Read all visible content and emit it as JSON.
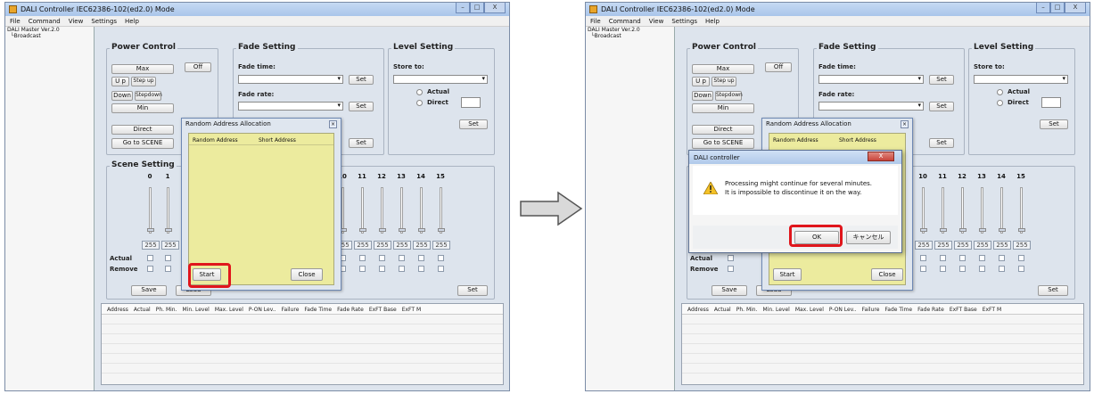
{
  "window": {
    "title": "DALI Controller IEC62386-102(ed2.0) Mode",
    "btn_min": "–",
    "btn_max": "□",
    "btn_close": "X"
  },
  "menu": [
    "File",
    "Command",
    "View",
    "Settings",
    "Help"
  ],
  "tree": {
    "root": "DALI Master Ver.2.0",
    "child": "Broadcast"
  },
  "power": {
    "title": "Power Control",
    "max": "Max",
    "off": "Off",
    "up": "U p",
    "step_up": "Step up",
    "down": "Down",
    "step_down": "Stepdown",
    "min": "Min",
    "direct": "Direct",
    "go_scene": "Go to SCENE"
  },
  "fade": {
    "title": "Fade Setting",
    "time": "Fade time:",
    "rate": "Fade rate:",
    "set": "Set"
  },
  "level": {
    "title": "Level Setting",
    "store_to": "Store to:",
    "actual": "Actual",
    "direct": "Direct",
    "set": "Set"
  },
  "scene": {
    "title": "Scene Setting",
    "left_numbers": [
      "0",
      "1"
    ],
    "right_numbers_left": [
      "9",
      "10",
      "11",
      "12",
      "13",
      "14",
      "15"
    ],
    "right_numbers_right": [
      "9",
      "10",
      "11",
      "12",
      "13",
      "14",
      "15"
    ],
    "value": "255",
    "actual": "Actual",
    "remove": "Remove",
    "save": "Save",
    "load": "Load",
    "set": "Set"
  },
  "table": {
    "headers_left": [
      "Address",
      "Actual",
      "Ph. Min.",
      "Min. Level",
      "Max. Level",
      "P-ON Lev..",
      "Failure",
      "Fade Time",
      "Fade Rate",
      "ExFT Base",
      "ExFT M"
    ],
    "headers_right": [
      "Address",
      "Actual",
      "Ph. Min.",
      "Min. Level",
      "Max. Level",
      "P-ON Lev..",
      "Failure",
      "Fade Time",
      "Fade Rate",
      "ExFT Base",
      "ExFT M"
    ]
  },
  "rand_dialog": {
    "title": "Random Address Allocation",
    "col_random": "Random Address",
    "col_short": "Short Address",
    "start": "Start",
    "close": "Close",
    "x": "×"
  },
  "alert": {
    "title": "DALI controller",
    "line1": "Processing might continue for several minutes.",
    "line2": "It is impossible to discontinue it on the way.",
    "ok": "OK",
    "cancel": "キャンセル",
    "x": "X"
  },
  "colors": {
    "highlight": "#e0161c",
    "dialog_bg": "#eceb9e",
    "arrow_fill": "#d9d9d9"
  }
}
